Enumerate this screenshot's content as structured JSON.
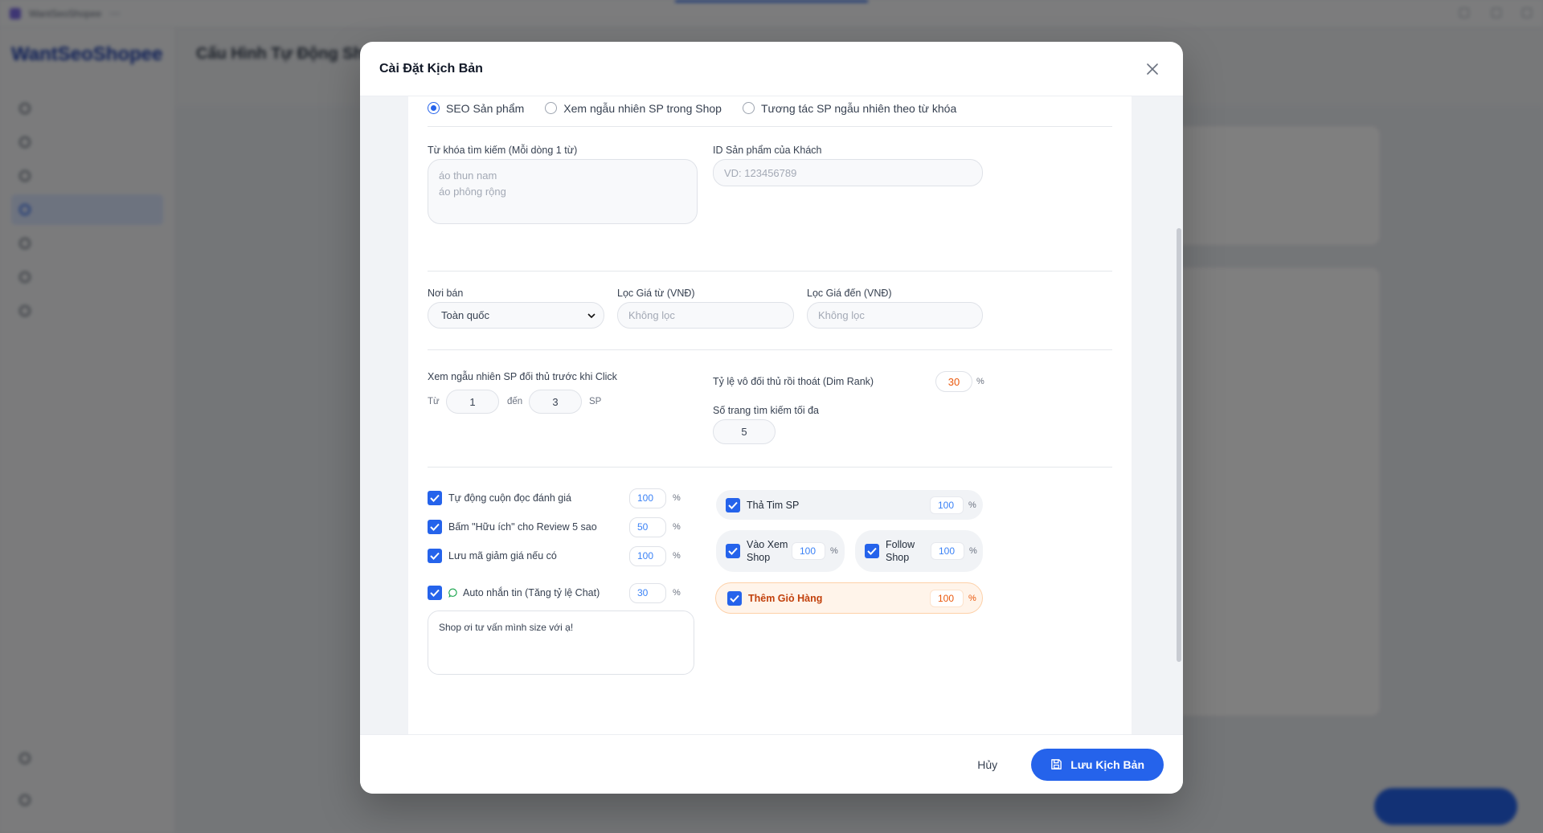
{
  "background": {
    "brand": "WantSeoShopee",
    "window_title": "WantSeoShopee",
    "page_title": "Cấu Hình Tự Động Shopee"
  },
  "modal": {
    "title": "Cài Đặt Kịch Bản",
    "modes": [
      {
        "label": "SEO Sản phẩm",
        "selected": true
      },
      {
        "label": "Xem ngẫu nhiên SP trong Shop",
        "selected": false
      },
      {
        "label": "Tương tác SP ngẫu nhiên theo từ khóa",
        "selected": false
      }
    ],
    "keywords": {
      "label": "Từ khóa tìm kiếm (Mỗi dòng 1 từ)",
      "placeholder": "áo thun nam\náo phông rộng"
    },
    "product_id": {
      "label": "ID Sản phẩm của Khách",
      "placeholder": "VD: 123456789"
    },
    "location": {
      "label": "Nơi bán",
      "value": "Toàn quốc"
    },
    "price_from": {
      "label": "Lọc Giá từ (VNĐ)",
      "placeholder": "Không lọc"
    },
    "price_to": {
      "label": "Lọc Giá đến (VNĐ)",
      "placeholder": "Không lọc"
    },
    "competitor_view": {
      "label": "Xem ngẫu nhiên SP đối thủ trước khi Click",
      "from_label": "Từ",
      "from_value": "1",
      "to_label": "đến",
      "to_value": "3",
      "unit": "SP"
    },
    "dim_rank": {
      "label": "Tỷ lệ vô đối thủ rồi thoát (Dim Rank)",
      "value": "30",
      "unit": "%"
    },
    "max_pages": {
      "label": "Số trang tìm kiếm tối đa",
      "value": "5"
    },
    "options": [
      {
        "label": "Tự động cuộn đọc đánh giá",
        "value": "100",
        "unit": "%",
        "checked": true
      },
      {
        "label": "Bấm \"Hữu ích\" cho Review 5 sao",
        "value": "50",
        "unit": "%",
        "checked": true
      },
      {
        "label": "Lưu mã giảm giá nếu có",
        "value": "100",
        "unit": "%",
        "checked": true
      },
      {
        "label": "Auto nhắn tin (Tăng tỷ lệ Chat)",
        "value": "30",
        "unit": "%",
        "checked": true
      }
    ],
    "chat_message": "Shop ơi tư vấn mình size với ạ!",
    "actions": {
      "like": {
        "label": "Thả Tim SP",
        "value": "100",
        "unit": "%",
        "checked": true
      },
      "visit_shop": {
        "label": "Vào Xem Shop",
        "value": "100",
        "unit": "%",
        "checked": true
      },
      "follow_shop": {
        "label": "Follow Shop",
        "value": "100",
        "unit": "%",
        "checked": true
      },
      "add_cart": {
        "label": "Thêm Giỏ Hàng",
        "value": "100",
        "unit": "%",
        "checked": true
      }
    },
    "footer": {
      "cancel": "Hủy",
      "save": "Lưu Kịch Bản"
    }
  },
  "colors": {
    "primary": "#2563eb",
    "accent_orange": "#ea580c",
    "cart_bg": "#fff4ea"
  }
}
